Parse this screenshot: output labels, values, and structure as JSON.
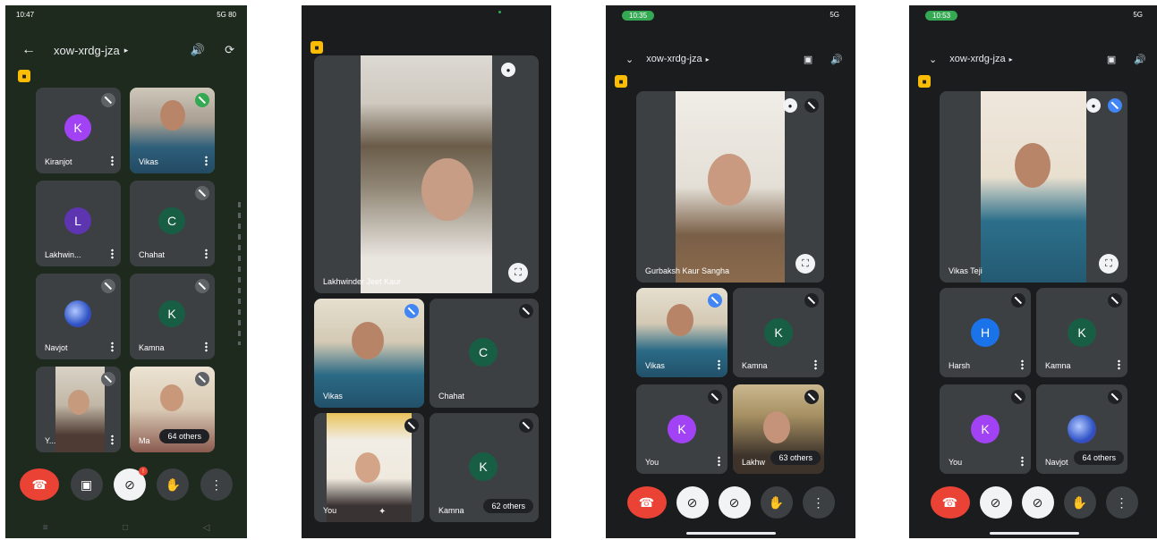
{
  "colors": {
    "bg": "#202124",
    "tile": "#3c4043",
    "end_call": "#ea4335",
    "active": "#34a853"
  },
  "p1": {
    "status_time": "10:47",
    "status_right": "5G 80",
    "meeting_code": "xow-xrdg-jza",
    "tiles": [
      {
        "name": "Kiranjot",
        "initial": "K",
        "color": "#a142f4"
      },
      {
        "name": "Vikas"
      },
      {
        "name": "Lakhwin...",
        "initial": "L",
        "color": "#5e35b1"
      },
      {
        "name": "Chahat",
        "initial": "C",
        "color": "#185e45"
      },
      {
        "name": "Navjot"
      },
      {
        "name": "Kamna",
        "initial": "K",
        "color": "#185e45"
      },
      {
        "name": "Y..."
      },
      {
        "name": "Ma",
        "others": "64 others"
      }
    ],
    "mic_badge": "!"
  },
  "p2": {
    "main_name": "Lakhwinder Jeet Kaur",
    "tiles": [
      {
        "name": "Vikas"
      },
      {
        "name": "Chahat",
        "initial": "C",
        "color": "#185e45"
      },
      {
        "name": "You"
      },
      {
        "name": "Kamna",
        "initial": "K",
        "color": "#185e45",
        "others": "62 others"
      }
    ]
  },
  "p3": {
    "status_time": "10:35",
    "status_right": "5G",
    "meeting_code": "xow-xrdg-jza",
    "main_name": "Gurbaksh Kaur Sangha",
    "tiles": [
      {
        "name": "Vikas"
      },
      {
        "name": "Kamna",
        "initial": "K",
        "color": "#185e45"
      },
      {
        "name": "You",
        "initial": "K",
        "color": "#a142f4"
      },
      {
        "name": "Lakhw",
        "others": "63 others"
      }
    ]
  },
  "p4": {
    "status_time": "10:53",
    "status_right": "5G",
    "meeting_code": "xow-xrdg-jza",
    "main_name": "Vikas Teji",
    "tiles": [
      {
        "name": "Harsh",
        "initial": "H",
        "color": "#1a73e8"
      },
      {
        "name": "Kamna",
        "initial": "K",
        "color": "#185e45"
      },
      {
        "name": "You",
        "initial": "K",
        "color": "#a142f4"
      },
      {
        "name": "Navjot",
        "others": "64 others"
      }
    ]
  },
  "icons": {
    "back": "arrow-left-icon",
    "speaker": "speaker-icon",
    "camera_flip": "camera-flip-icon",
    "chevron": "chevron-down-icon",
    "end": "end-call-icon",
    "video": "video-icon",
    "mic": "mic-off-icon",
    "hand": "raise-hand-icon",
    "more": "more-vert-icon",
    "fullscreen": "fullscreen-icon",
    "pin": "pin-icon"
  }
}
